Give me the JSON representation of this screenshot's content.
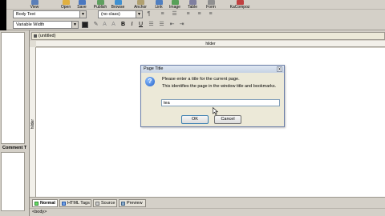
{
  "toolbar": {
    "buttons": [
      {
        "label": "View",
        "color": "#5b7fb8"
      },
      {
        "label": "Open",
        "color": "#e0b040"
      },
      {
        "label": "Save",
        "color": "#4a78c0"
      },
      {
        "label": "Publish",
        "color": "#60a060"
      },
      {
        "label": "Browse",
        "color": "#4090d0"
      },
      {
        "label": "Anchor",
        "color": "#b0a070"
      },
      {
        "label": "Link",
        "color": "#507fc0"
      },
      {
        "label": "Image",
        "color": "#58a058"
      },
      {
        "label": "Table",
        "color": "#8080a0"
      },
      {
        "label": "Form",
        "color": "#909090"
      },
      {
        "label": "KaCompoz",
        "color": "#c04040"
      }
    ]
  },
  "format_bar": {
    "paragraph_style": "Body Text",
    "class_select": "(no class)",
    "font_select": "Variable Width",
    "bold": "B",
    "italic": "I",
    "underline": "U"
  },
  "document": {
    "tab_label": "(untitled)",
    "ruler_label": "hilder",
    "side_label": "hilder"
  },
  "left_panel": {
    "comment_label": "Comment T"
  },
  "bottom_tabs": [
    {
      "label": "Normal",
      "active": true
    },
    {
      "label": "HTML Tags",
      "active": false
    },
    {
      "label": "Source",
      "active": false
    },
    {
      "label": "Preview",
      "active": false
    }
  ],
  "status": {
    "text": "<body>"
  },
  "dialog": {
    "title": "Page Title",
    "close_glyph": "x",
    "icon_glyph": "?",
    "message_line1": "Please enter a title for the current page.",
    "message_line2": "This identifies the page in the window title and bookmarks.",
    "input_value": "tea",
    "ok_label": "OK",
    "cancel_label": "Cancel"
  }
}
